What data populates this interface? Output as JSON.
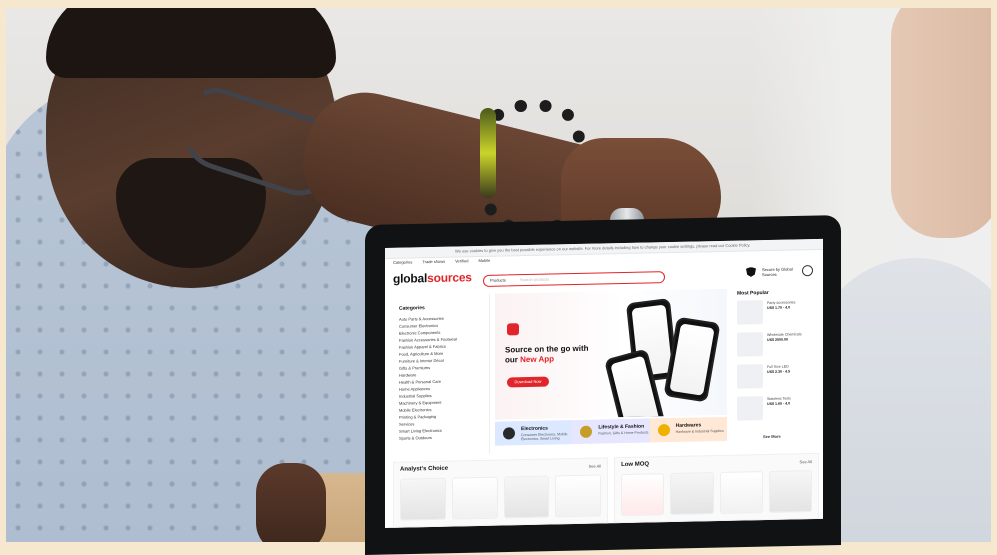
{
  "site": {
    "logo_left": "global",
    "logo_right": "sources",
    "announcement": "We use cookies to give you the best possible experience on our website. For more details including how to change your cookie settings, please read our Cookie Policy.",
    "nav": [
      "Categories",
      "Trade shows",
      "Verified",
      "Mobile"
    ],
    "search_scope": "Products",
    "search_placeholder": "Search products",
    "secure_label": "Secure by Global Sources"
  },
  "categories": {
    "title": "Categories",
    "items": [
      "Auto Parts & Accessories",
      "Consumer Electronics",
      "Electronic Components",
      "Fashion Accessories & Footwear",
      "Fashion Apparel & Fabrics",
      "Food, Agriculture & More",
      "Furniture & Interior Décor",
      "Gifts & Premiums",
      "Hardware",
      "Health & Personal Care",
      "Home Appliances",
      "Industrial Supplies",
      "Machinery & Equipment",
      "Mobile Electronics",
      "Printing & Packaging",
      "Services",
      "Smart Living Electronics",
      "Sports & Outdoors"
    ]
  },
  "hero": {
    "line1": "Source on the go with",
    "line2_prefix": "our ",
    "line2_highlight": "New App",
    "button": "Download Now"
  },
  "banners": [
    {
      "title": "Electronics",
      "subtitle": "Consumer Electronics, Mobile Electronics, Smart Living"
    },
    {
      "title": "Lifestyle & Fashion",
      "subtitle": "Fashion, Gifts & Home Products"
    },
    {
      "title": "Hardwares",
      "subtitle": "Hardware & Industrial Supplies"
    }
  ],
  "most_popular": {
    "title": "Most Popular",
    "items": [
      {
        "desc": "Party accessories",
        "price": "US$ 1.70 - 4.0"
      },
      {
        "desc": "Wholesale Chemicals",
        "price": "US$ 2500.00"
      },
      {
        "desc": "Full Size LED",
        "price": "US$ 2.30 - 4.5"
      },
      {
        "desc": "Stainless Tools",
        "price": "US$ 1.60 - 4.0"
      }
    ],
    "see_more": "See More"
  },
  "sections": {
    "analyst": {
      "title": "Analyst's Choice",
      "see_all": "See All"
    },
    "low_moq": {
      "title": "Low MOQ",
      "see_all": "See All"
    }
  },
  "colors": {
    "brand_red": "#e1252b",
    "page_bg": "#f6e7cf"
  }
}
